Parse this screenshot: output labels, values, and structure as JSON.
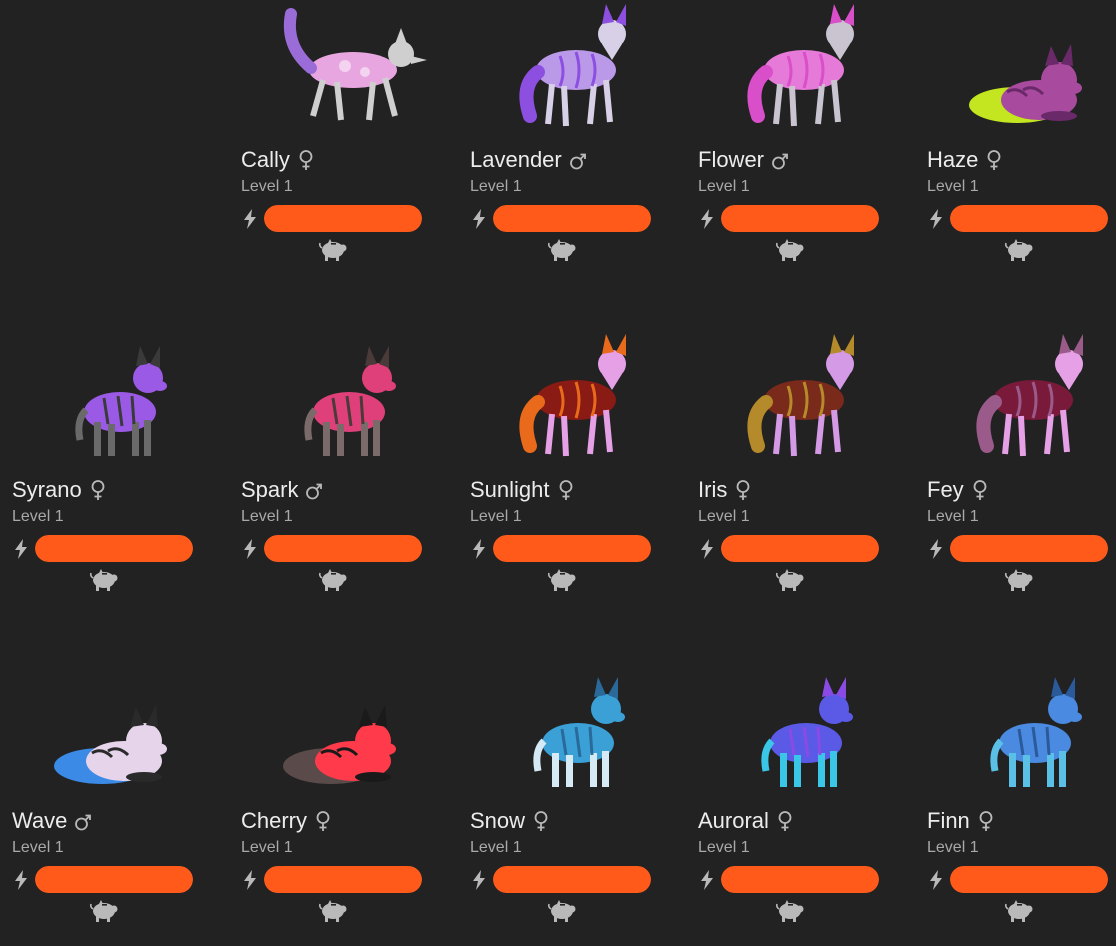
{
  "theme": {
    "background": "#222222",
    "energy_color": "#ff5a1a",
    "icon_color": "#b9b9b9"
  },
  "icons": {
    "energy": "lightning-bolt-icon",
    "feed": "piggy-bank-icon",
    "female": "female-symbol-icon",
    "male": "male-symbol-icon"
  },
  "level_label": "Level 1",
  "pets": [
    {
      "name": "Cally",
      "gender": "female",
      "level": "Level 1",
      "energy": 1.0,
      "pose": "walk",
      "palette": [
        "#e8a6e0",
        "#cfcfcf",
        "#9a6cd8"
      ]
    },
    {
      "name": "Lavender",
      "gender": "male",
      "level": "Level 1",
      "energy": 1.0,
      "pose": "stand",
      "palette": [
        "#b999e8",
        "#d8d0e6",
        "#8d4fe0"
      ]
    },
    {
      "name": "Flower",
      "gender": "male",
      "level": "Level 1",
      "energy": 1.0,
      "pose": "stand",
      "palette": [
        "#e67ad8",
        "#c9c4d0",
        "#d94ec9"
      ]
    },
    {
      "name": "Haze",
      "gender": "female",
      "level": "Level 1",
      "energy": 1.0,
      "pose": "lie",
      "palette": [
        "#a84a9e",
        "#c3e620",
        "#6a2a6a"
      ]
    },
    {
      "name": "Syrano",
      "gender": "female",
      "level": "Level 1",
      "energy": 1.0,
      "pose": "cub",
      "palette": [
        "#9a5ae6",
        "#6a6a6a",
        "#3a3a3a"
      ]
    },
    {
      "name": "Spark",
      "gender": "male",
      "level": "Level 1",
      "energy": 1.0,
      "pose": "cub",
      "palette": [
        "#e0407a",
        "#7a6a6a",
        "#4a3a3a"
      ]
    },
    {
      "name": "Sunlight",
      "gender": "female",
      "level": "Level 1",
      "energy": 1.0,
      "pose": "stand",
      "palette": [
        "#8a1a14",
        "#e6a0e6",
        "#e86a1a"
      ]
    },
    {
      "name": "Iris",
      "gender": "female",
      "level": "Level 1",
      "energy": 1.0,
      "pose": "stand",
      "palette": [
        "#7a2a1a",
        "#d59ae6",
        "#b58a2a"
      ]
    },
    {
      "name": "Fey",
      "gender": "female",
      "level": "Level 1",
      "energy": 1.0,
      "pose": "stand",
      "palette": [
        "#7a1a3a",
        "#e6a0e6",
        "#9a5a8a"
      ]
    },
    {
      "name": "Wave",
      "gender": "male",
      "level": "Level 1",
      "energy": 1.0,
      "pose": "lie",
      "palette": [
        "#e6d4ea",
        "#3a8ae6",
        "#2a2a2a"
      ]
    },
    {
      "name": "Cherry",
      "gender": "female",
      "level": "Level 1",
      "energy": 1.0,
      "pose": "lie",
      "palette": [
        "#ff3a4a",
        "#5a4a4a",
        "#1a1a1a"
      ]
    },
    {
      "name": "Snow",
      "gender": "female",
      "level": "Level 1",
      "energy": 1.0,
      "pose": "cub",
      "palette": [
        "#3aa0d6",
        "#d6eaf6",
        "#2a6a9a"
      ]
    },
    {
      "name": "Auroral",
      "gender": "female",
      "level": "Level 1",
      "energy": 1.0,
      "pose": "cub",
      "palette": [
        "#5a5ae6",
        "#3ac6e6",
        "#8a4ae6"
      ]
    },
    {
      "name": "Finn",
      "gender": "female",
      "level": "Level 1",
      "energy": 1.0,
      "pose": "cub",
      "palette": [
        "#4a8ae0",
        "#5ac0e6",
        "#2a5a9a"
      ]
    }
  ]
}
